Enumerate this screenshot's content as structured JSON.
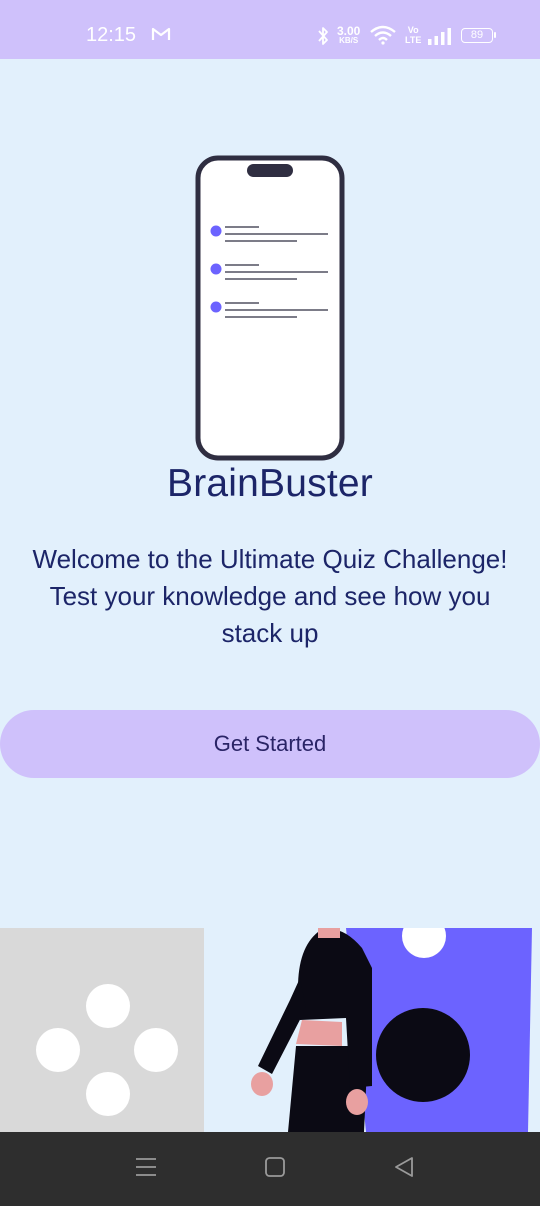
{
  "status_bar": {
    "time": "12:15",
    "network_speed_value": "3.00",
    "network_speed_unit": "KB/S",
    "volte_top": "Vo",
    "volte_bottom": "LTE",
    "battery_level": "89",
    "icons": [
      "gmail-icon",
      "bluetooth-icon",
      "wifi-icon",
      "volte-icon",
      "signal-icon",
      "battery-icon"
    ]
  },
  "app": {
    "title": "BrainBuster",
    "welcome_lines": [
      "Welcome to the Ultimate Quiz Challenge!",
      "Test your knowledge and see how you",
      "stack up"
    ],
    "cta_label": "Get Started"
  },
  "nav_bar": {
    "icons": [
      "menu-icon",
      "home-icon",
      "back-icon"
    ]
  },
  "colors": {
    "background": "#e2f0fc",
    "accent": "#cfc1fb",
    "title_text": "#1c2568",
    "illustration_purple": "#6c63ff",
    "nav_bar": "#2e2e2e"
  }
}
